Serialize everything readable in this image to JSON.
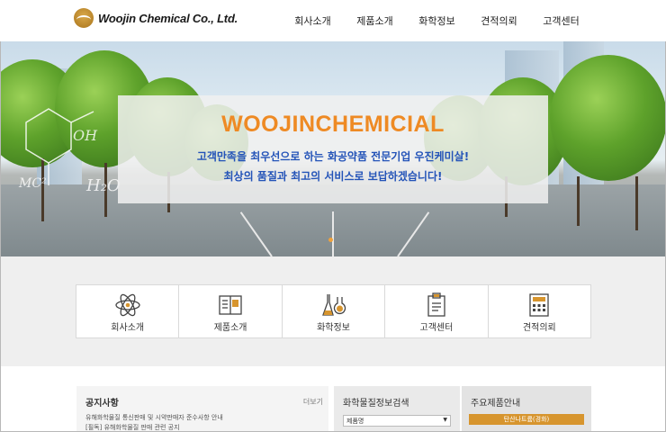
{
  "header": {
    "logo_text": "Woojin Chemical Co., Ltd.",
    "nav": [
      "회사소개",
      "제품소개",
      "화학정보",
      "견적의뢰",
      "고객센터"
    ]
  },
  "hero": {
    "title": "WOOJINCHEMICIAL",
    "line1": "고객만족을 최우선으로 하는 화공약품 전문기업 우진케미살!",
    "line2": "최상의 품질과 최고의 서비스로 보답하겠습니다!",
    "accent_color": "#ee8a24",
    "sub_color": "#2353b8"
  },
  "quick_menu": [
    {
      "label": "회사소개",
      "icon": "atom-icon"
    },
    {
      "label": "제품소개",
      "icon": "book-icon"
    },
    {
      "label": "화학정보",
      "icon": "flask-icon"
    },
    {
      "label": "고객센터",
      "icon": "clipboard-icon"
    },
    {
      "label": "견적의뢰",
      "icon": "calculator-icon"
    }
  ],
  "notice": {
    "title": "공지사항",
    "more": "더보기",
    "items": [
      "유해화학물질 통신판매 및 시약판매자 준수사항 안내",
      "[필독] 유해화학물질 판매 관련 공지"
    ]
  },
  "search": {
    "title": "화학물질정보검색",
    "select_value": "제품명"
  },
  "product": {
    "title": "주요제품안내",
    "tag": "탄산나트륨(경화)",
    "tag_color": "#d7952e"
  }
}
